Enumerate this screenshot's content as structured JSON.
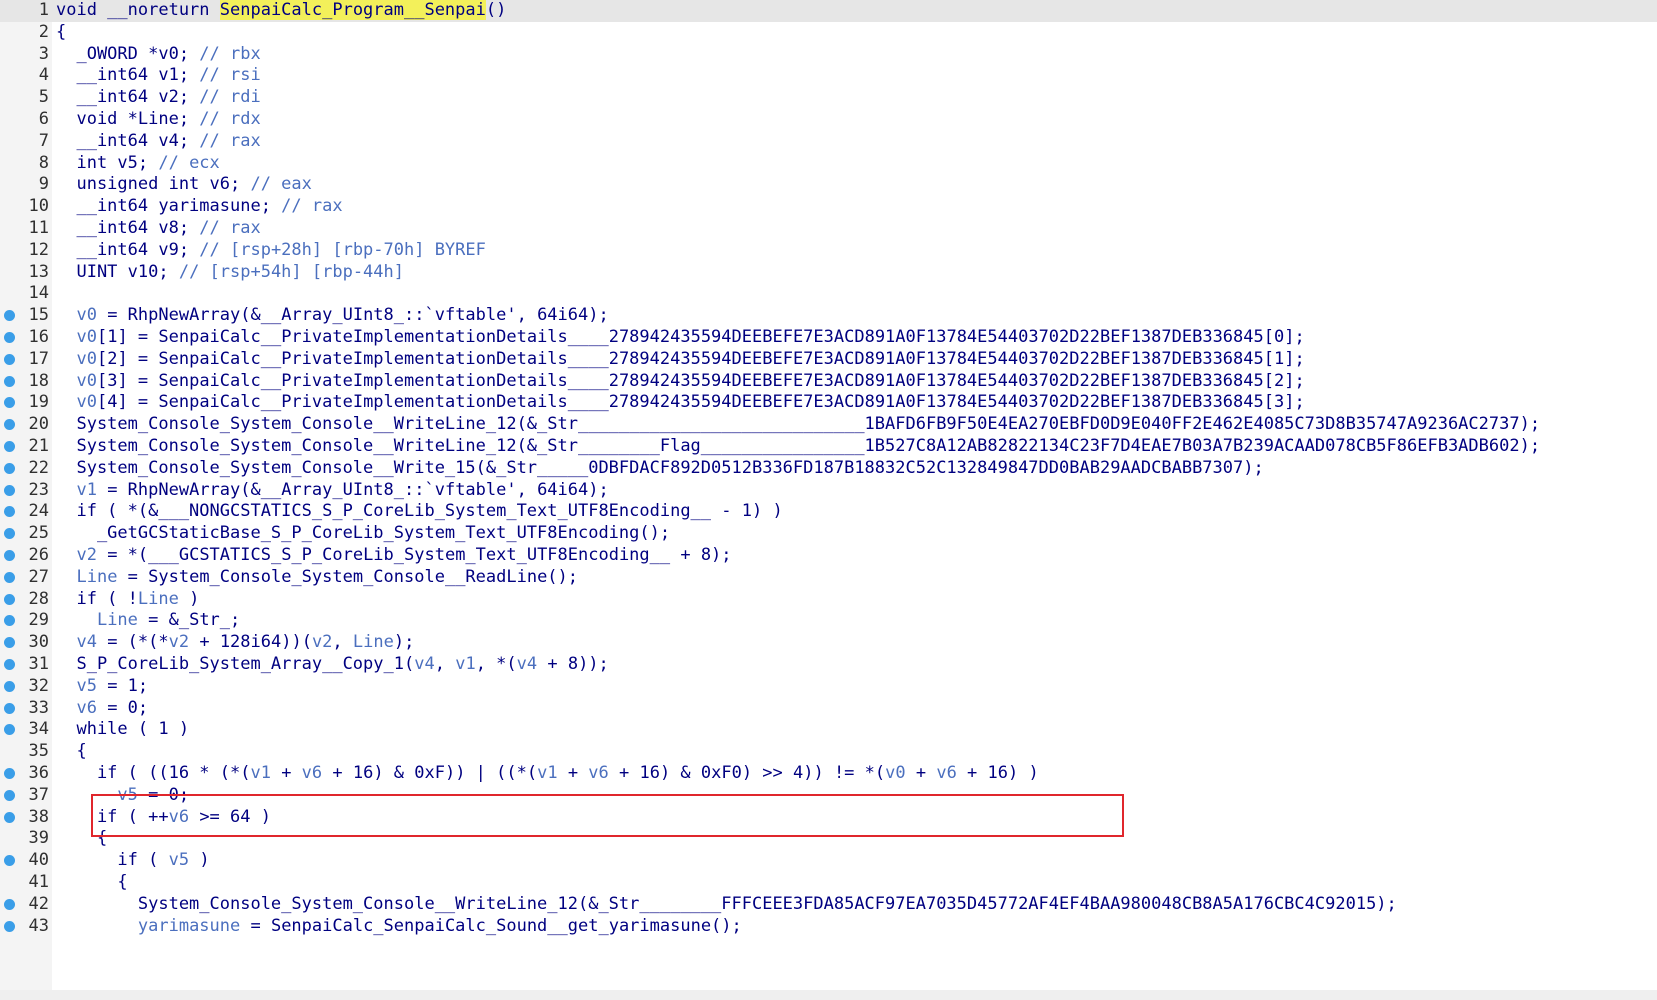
{
  "colors": {
    "breakpoint": "#3a9ee8",
    "highlight_box": "#e0262c",
    "identifier_highlight": "#f3f05a",
    "comment": "#4b6fbe",
    "code": "#000080"
  },
  "lines": [
    {
      "n": "1",
      "bp": false,
      "segs": [
        [
          "t",
          "void __noreturn "
        ],
        [
          "h",
          "SenpaiCalc_Program__Senpai"
        ],
        [
          "t",
          "()"
        ]
      ]
    },
    {
      "n": "2",
      "bp": false,
      "segs": [
        [
          "t",
          "{"
        ]
      ]
    },
    {
      "n": "3",
      "bp": false,
      "segs": [
        [
          "t",
          "  _OWORD *v0; "
        ],
        [
          "c",
          "// rbx"
        ]
      ]
    },
    {
      "n": "4",
      "bp": false,
      "segs": [
        [
          "t",
          "  __int64 v1; "
        ],
        [
          "c",
          "// rsi"
        ]
      ]
    },
    {
      "n": "5",
      "bp": false,
      "segs": [
        [
          "t",
          "  __int64 v2; "
        ],
        [
          "c",
          "// rdi"
        ]
      ]
    },
    {
      "n": "6",
      "bp": false,
      "segs": [
        [
          "t",
          "  void *Line; "
        ],
        [
          "c",
          "// rdx"
        ]
      ]
    },
    {
      "n": "7",
      "bp": false,
      "segs": [
        [
          "t",
          "  __int64 v4; "
        ],
        [
          "c",
          "// rax"
        ]
      ]
    },
    {
      "n": "8",
      "bp": false,
      "segs": [
        [
          "t",
          "  int v5; "
        ],
        [
          "c",
          "// ecx"
        ]
      ]
    },
    {
      "n": "9",
      "bp": false,
      "segs": [
        [
          "t",
          "  unsigned int v6; "
        ],
        [
          "c",
          "// eax"
        ]
      ]
    },
    {
      "n": "10",
      "bp": false,
      "segs": [
        [
          "t",
          "  __int64 yarimasune; "
        ],
        [
          "c",
          "// rax"
        ]
      ]
    },
    {
      "n": "11",
      "bp": false,
      "segs": [
        [
          "t",
          "  __int64 v8; "
        ],
        [
          "c",
          "// rax"
        ]
      ]
    },
    {
      "n": "12",
      "bp": false,
      "segs": [
        [
          "t",
          "  __int64 v9; "
        ],
        [
          "c",
          "// [rsp+28h] [rbp-70h] BYREF"
        ]
      ]
    },
    {
      "n": "13",
      "bp": false,
      "segs": [
        [
          "t",
          "  UINT v10; "
        ],
        [
          "c",
          "// [rsp+54h] [rbp-44h]"
        ]
      ]
    },
    {
      "n": "14",
      "bp": false,
      "segs": []
    },
    {
      "n": "15",
      "bp": true,
      "segs": [
        [
          "t",
          "  "
        ],
        [
          "v",
          "v0"
        ],
        [
          "t",
          " = RhpNewArray(&__Array_UInt8_::`vftable', 64i64);"
        ]
      ]
    },
    {
      "n": "16",
      "bp": true,
      "segs": [
        [
          "t",
          "  "
        ],
        [
          "v",
          "v0"
        ],
        [
          "t",
          "[1] = SenpaiCalc__PrivateImplementationDetails____278942435594DEEBEFE7E3ACD891A0F13784E54403702D22BEF1387DEB336845[0];"
        ]
      ]
    },
    {
      "n": "17",
      "bp": true,
      "segs": [
        [
          "t",
          "  "
        ],
        [
          "v",
          "v0"
        ],
        [
          "t",
          "[2] = SenpaiCalc__PrivateImplementationDetails____278942435594DEEBEFE7E3ACD891A0F13784E54403702D22BEF1387DEB336845[1];"
        ]
      ]
    },
    {
      "n": "18",
      "bp": true,
      "segs": [
        [
          "t",
          "  "
        ],
        [
          "v",
          "v0"
        ],
        [
          "t",
          "[3] = SenpaiCalc__PrivateImplementationDetails____278942435594DEEBEFE7E3ACD891A0F13784E54403702D22BEF1387DEB336845[2];"
        ]
      ]
    },
    {
      "n": "19",
      "bp": true,
      "segs": [
        [
          "t",
          "  "
        ],
        [
          "v",
          "v0"
        ],
        [
          "t",
          "[4] = SenpaiCalc__PrivateImplementationDetails____278942435594DEEBEFE7E3ACD891A0F13784E54403702D22BEF1387DEB336845[3];"
        ]
      ]
    },
    {
      "n": "20",
      "bp": true,
      "segs": [
        [
          "t",
          "  System_Console_System_Console__WriteLine_12(&_Str____________________________1BAFD6FB9F50E4EA270EBFD0D9E040FF2E462E4085C73D8B35747A9236AC2737);"
        ]
      ]
    },
    {
      "n": "21",
      "bp": true,
      "segs": [
        [
          "t",
          "  System_Console_System_Console__WriteLine_12(&_Str________Flag________________1B527C8A12AB82822134C23F7D4EAE7B03A7B239ACAAD078CB5F86EFB3ADB602);"
        ]
      ]
    },
    {
      "n": "22",
      "bp": true,
      "segs": [
        [
          "t",
          "  System_Console_System_Console__Write_15(&_Str_____0DBFDACF892D0512B336FD187B18832C52C132849847DD0BAB29AADCBABB7307);"
        ]
      ]
    },
    {
      "n": "23",
      "bp": true,
      "segs": [
        [
          "t",
          "  "
        ],
        [
          "v",
          "v1"
        ],
        [
          "t",
          " = RhpNewArray(&__Array_UInt8_::`vftable', 64i64);"
        ]
      ]
    },
    {
      "n": "24",
      "bp": true,
      "segs": [
        [
          "t",
          "  if ( *(&___NONGCSTATICS_S_P_CoreLib_System_Text_UTF8Encoding__ - 1) )"
        ]
      ]
    },
    {
      "n": "25",
      "bp": true,
      "segs": [
        [
          "t",
          "    _GetGCStaticBase_S_P_CoreLib_System_Text_UTF8Encoding();"
        ]
      ]
    },
    {
      "n": "26",
      "bp": true,
      "segs": [
        [
          "t",
          "  "
        ],
        [
          "v",
          "v2"
        ],
        [
          "t",
          " = *(___GCSTATICS_S_P_CoreLib_System_Text_UTF8Encoding__ + 8);"
        ]
      ]
    },
    {
      "n": "27",
      "bp": true,
      "segs": [
        [
          "t",
          "  "
        ],
        [
          "v",
          "Line"
        ],
        [
          "t",
          " = System_Console_System_Console__ReadLine();"
        ]
      ]
    },
    {
      "n": "28",
      "bp": true,
      "segs": [
        [
          "t",
          "  if ( !"
        ],
        [
          "v",
          "Line"
        ],
        [
          "t",
          " )"
        ]
      ]
    },
    {
      "n": "29",
      "bp": true,
      "segs": [
        [
          "t",
          "    "
        ],
        [
          "v",
          "Line"
        ],
        [
          "t",
          " = &_Str_;"
        ]
      ]
    },
    {
      "n": "30",
      "bp": true,
      "segs": [
        [
          "t",
          "  "
        ],
        [
          "v",
          "v4"
        ],
        [
          "t",
          " = (*(*"
        ],
        [
          "v",
          "v2"
        ],
        [
          "t",
          " + 128i64))("
        ],
        [
          "v",
          "v2"
        ],
        [
          "t",
          ", "
        ],
        [
          "v",
          "Line"
        ],
        [
          "t",
          ");"
        ]
      ]
    },
    {
      "n": "31",
      "bp": true,
      "segs": [
        [
          "t",
          "  S_P_CoreLib_System_Array__Copy_1("
        ],
        [
          "v",
          "v4"
        ],
        [
          "t",
          ", "
        ],
        [
          "v",
          "v1"
        ],
        [
          "t",
          ", *("
        ],
        [
          "v",
          "v4"
        ],
        [
          "t",
          " + 8));"
        ]
      ]
    },
    {
      "n": "32",
      "bp": true,
      "segs": [
        [
          "t",
          "  "
        ],
        [
          "v",
          "v5"
        ],
        [
          "t",
          " = 1;"
        ]
      ]
    },
    {
      "n": "33",
      "bp": true,
      "segs": [
        [
          "t",
          "  "
        ],
        [
          "v",
          "v6"
        ],
        [
          "t",
          " = 0;"
        ]
      ]
    },
    {
      "n": "34",
      "bp": true,
      "segs": [
        [
          "t",
          "  while ( 1 )"
        ]
      ]
    },
    {
      "n": "35",
      "bp": false,
      "segs": [
        [
          "t",
          "  {"
        ]
      ]
    },
    {
      "n": "36",
      "bp": true,
      "segs": [
        [
          "t",
          "    if ( ((16 * (*("
        ],
        [
          "v",
          "v1"
        ],
        [
          "t",
          " + "
        ],
        [
          "v",
          "v6"
        ],
        [
          "t",
          " + 16) & 0xF)) | ((*("
        ],
        [
          "v",
          "v1"
        ],
        [
          "t",
          " + "
        ],
        [
          "v",
          "v6"
        ],
        [
          "t",
          " + 16) & 0xF0) >> 4)) != *("
        ],
        [
          "v",
          "v0"
        ],
        [
          "t",
          " + "
        ],
        [
          "v",
          "v6"
        ],
        [
          "t",
          " + 16) )"
        ]
      ]
    },
    {
      "n": "37",
      "bp": true,
      "segs": [
        [
          "t",
          "      "
        ],
        [
          "v",
          "v5"
        ],
        [
          "t",
          " = 0;"
        ]
      ]
    },
    {
      "n": "38",
      "bp": true,
      "segs": [
        [
          "t",
          "    if ( ++"
        ],
        [
          "v",
          "v6"
        ],
        [
          "t",
          " >= 64 )"
        ]
      ]
    },
    {
      "n": "39",
      "bp": false,
      "segs": [
        [
          "t",
          "    {"
        ]
      ]
    },
    {
      "n": "40",
      "bp": true,
      "segs": [
        [
          "t",
          "      if ( "
        ],
        [
          "v",
          "v5"
        ],
        [
          "t",
          " )"
        ]
      ]
    },
    {
      "n": "41",
      "bp": false,
      "segs": [
        [
          "t",
          "      {"
        ]
      ]
    },
    {
      "n": "42",
      "bp": true,
      "segs": [
        [
          "t",
          "        System_Console_System_Console__WriteLine_12(&_Str________FFFCEEE3FDA85ACF97EA7035D45772AF4EF4BAA980048CB8A5A176CBC4C92015);"
        ]
      ]
    },
    {
      "n": "43",
      "bp": true,
      "segs": [
        [
          "t",
          "        "
        ],
        [
          "v",
          "yarimasune"
        ],
        [
          "t",
          " = SenpaiCalc_SenpaiCalc_Sound__get_yarimasune();"
        ]
      ]
    }
  ]
}
